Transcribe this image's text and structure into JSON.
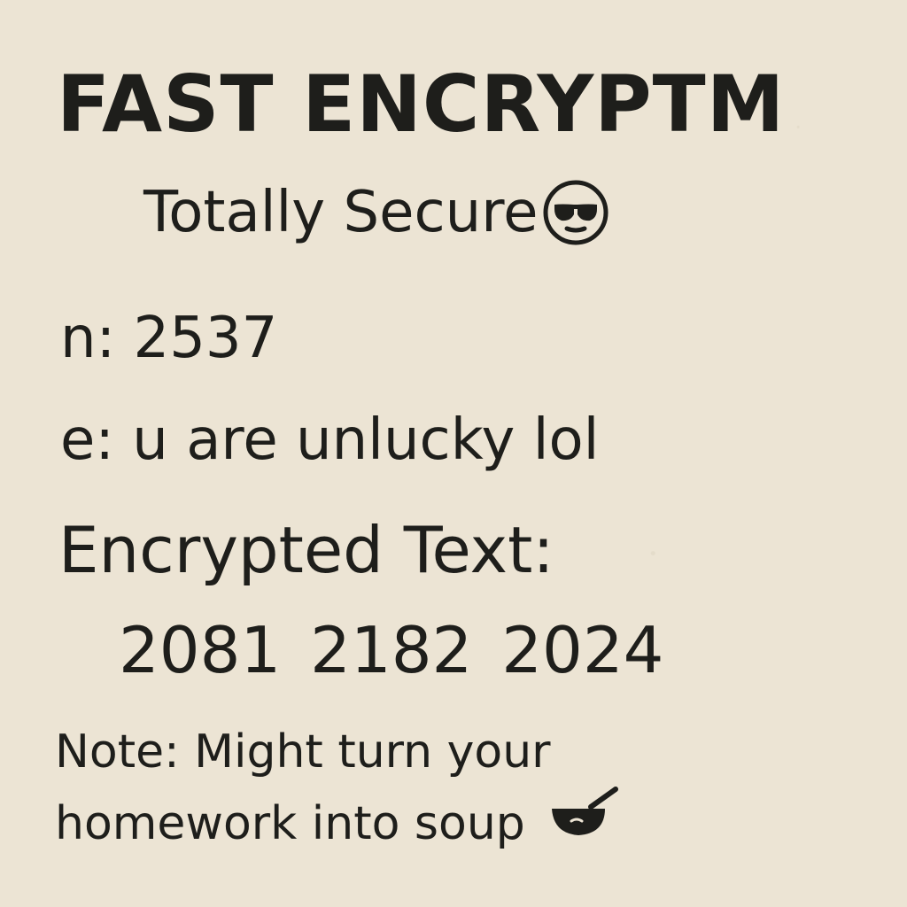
{
  "title": "FAST ENCRYPTM",
  "subtitle": "Totally Secure",
  "n": {
    "label": "n:",
    "value": "2537"
  },
  "e": {
    "label": "e:",
    "value": "u are unlucky lol"
  },
  "encrypted": {
    "label": "Encrypted Text:",
    "values": "2081 2182 2024"
  },
  "note": {
    "line1": "Note: Might turn your",
    "line2": "homework into soup"
  },
  "icons": {
    "subtitle_emoji": "sunglasses-face-icon",
    "note_emoji": "soup-bowl-icon"
  },
  "colors": {
    "paper": "#ece4d4",
    "ink": "#1e1e1b"
  }
}
